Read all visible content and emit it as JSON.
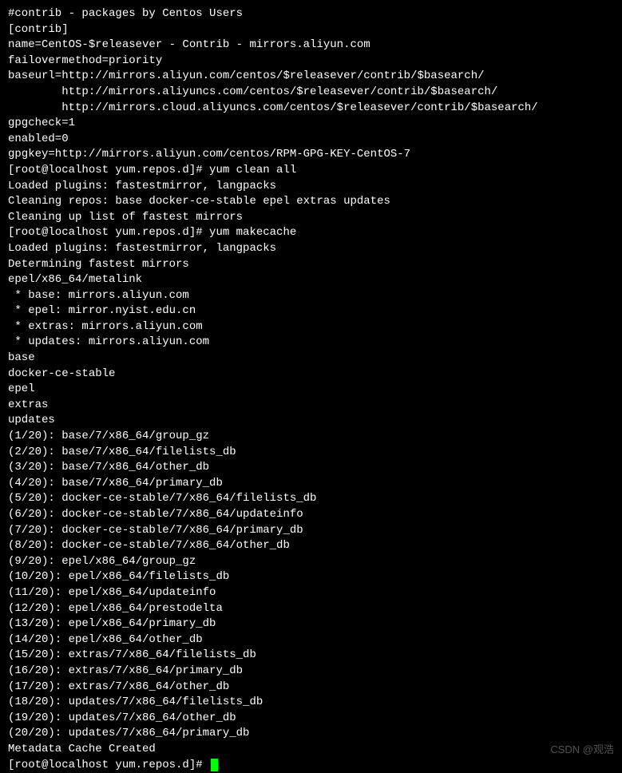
{
  "lines": [
    "#contrib - packages by Centos Users",
    "[contrib]",
    "name=CentOS-$releasever - Contrib - mirrors.aliyun.com",
    "failovermethod=priority",
    "baseurl=http://mirrors.aliyun.com/centos/$releasever/contrib/$basearch/",
    "        http://mirrors.aliyuncs.com/centos/$releasever/contrib/$basearch/",
    "        http://mirrors.cloud.aliyuncs.com/centos/$releasever/contrib/$basearch/",
    "gpgcheck=1",
    "enabled=0",
    "gpgkey=http://mirrors.aliyun.com/centos/RPM-GPG-KEY-CentOS-7",
    "[root@localhost yum.repos.d]# yum clean all",
    "Loaded plugins: fastestmirror, langpacks",
    "Cleaning repos: base docker-ce-stable epel extras updates",
    "Cleaning up list of fastest mirrors",
    "[root@localhost yum.repos.d]# yum makecache",
    "Loaded plugins: fastestmirror, langpacks",
    "Determining fastest mirrors",
    "epel/x86_64/metalink",
    " * base: mirrors.aliyun.com",
    " * epel: mirror.nyist.edu.cn",
    " * extras: mirrors.aliyun.com",
    " * updates: mirrors.aliyun.com",
    "base",
    "docker-ce-stable",
    "epel",
    "extras",
    "updates",
    "(1/20): base/7/x86_64/group_gz",
    "(2/20): base/7/x86_64/filelists_db",
    "(3/20): base/7/x86_64/other_db",
    "(4/20): base/7/x86_64/primary_db",
    "(5/20): docker-ce-stable/7/x86_64/filelists_db",
    "(6/20): docker-ce-stable/7/x86_64/updateinfo",
    "(7/20): docker-ce-stable/7/x86_64/primary_db",
    "(8/20): docker-ce-stable/7/x86_64/other_db",
    "(9/20): epel/x86_64/group_gz",
    "(10/20): epel/x86_64/filelists_db",
    "(11/20): epel/x86_64/updateinfo",
    "(12/20): epel/x86_64/prestodelta",
    "(13/20): epel/x86_64/primary_db",
    "(14/20): epel/x86_64/other_db",
    "(15/20): extras/7/x86_64/filelists_db",
    "(16/20): extras/7/x86_64/primary_db",
    "(17/20): extras/7/x86_64/other_db",
    "(18/20): updates/7/x86_64/filelists_db",
    "(19/20): updates/7/x86_64/other_db",
    "(20/20): updates/7/x86_64/primary_db",
    "Metadata Cache Created"
  ],
  "prompt": "[root@localhost yum.repos.d]# ",
  "watermark": "CSDN @观浩"
}
